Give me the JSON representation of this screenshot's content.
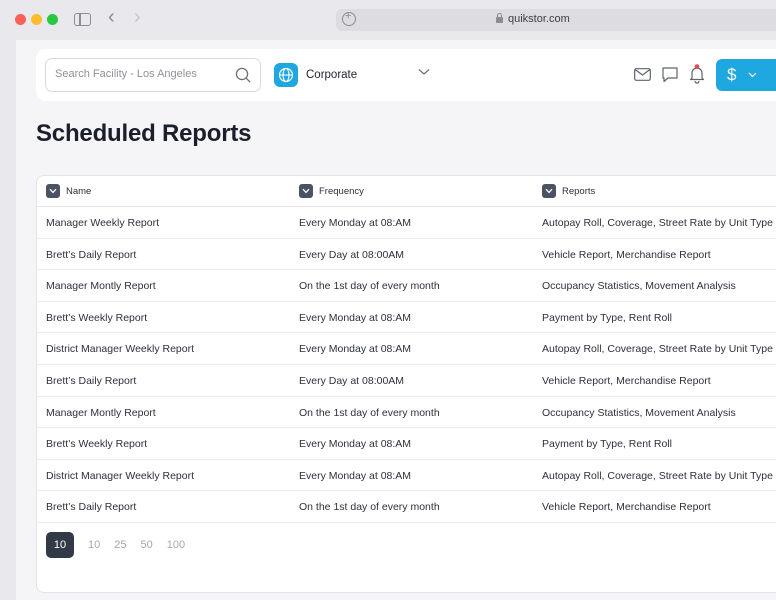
{
  "browser": {
    "url": "quikstor.com"
  },
  "header": {
    "search_placeholder": "Search Facility - Los Angeles",
    "facility_label": "Corporate",
    "pay_symbol": "$"
  },
  "page": {
    "title": "Scheduled Reports"
  },
  "table": {
    "columns": [
      "Name",
      "Frequency",
      "Reports"
    ],
    "rows": [
      [
        "Manager Weekly Report",
        "Every Monday at 08:AM",
        "Autopay Roll, Coverage, Street Rate by Unit Type"
      ],
      [
        "Brett’s Daily Report",
        "Every Day at 08:00AM",
        "Vehicle Report, Merchandise Report"
      ],
      [
        "Manager Montly Report",
        "On the 1st day of every month",
        "Occupancy Statistics, Movement Analysis"
      ],
      [
        "Brett’s Weekly Report",
        "Every Monday at 08:AM",
        "Payment by Type, Rent Roll"
      ],
      [
        "District Manager Weekly Report",
        "Every Monday at 08:AM",
        "Autopay Roll, Coverage, Street Rate by Unit Type +"
      ],
      [
        "Brett’s Daily Report",
        "Every Day at 08:00AM",
        "Vehicle Report, Merchandise Report"
      ],
      [
        "Manager Montly Report",
        "On the 1st day of every month",
        "Occupancy Statistics, Movement Analysis"
      ],
      [
        "Brett’s Weekly Report",
        "Every Monday at 08:AM",
        "Payment by Type, Rent Roll"
      ],
      [
        "District Manager Weekly Report",
        "Every Monday at 08:AM",
        "Autopay Roll, Coverage, Street Rate by Unit Type"
      ],
      [
        "Brett’s Daily Report",
        "On the 1st day of every month",
        "Vehicle Report, Merchandise Report"
      ]
    ]
  },
  "pagination": {
    "sizes": [
      "10",
      "10",
      "25",
      "50",
      "100"
    ],
    "active_index": 0
  },
  "colors": {
    "accent": "#1fa7e0",
    "notification_dot": "#ef4444",
    "dark_button": "#333a47"
  }
}
